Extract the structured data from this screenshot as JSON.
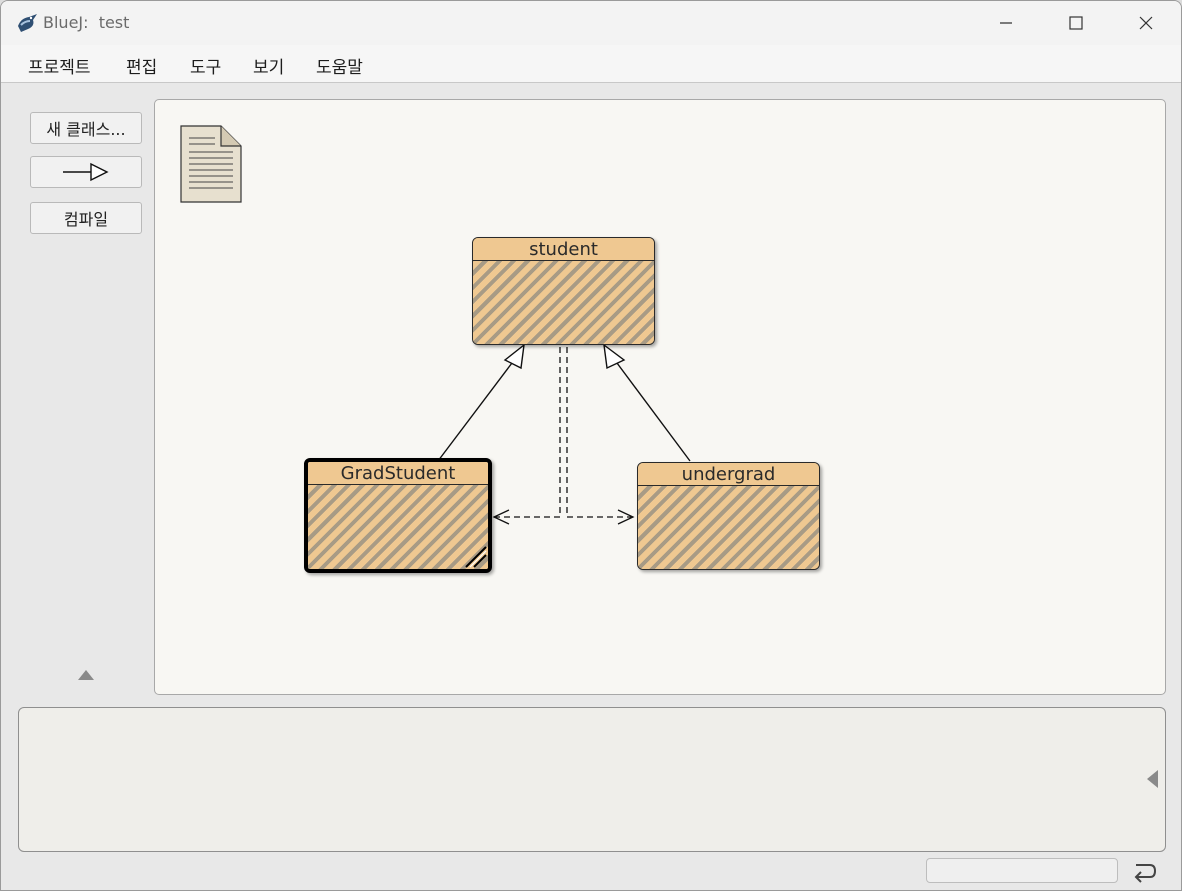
{
  "window": {
    "app_name": "BlueJ:",
    "project_name": "test",
    "title": "BlueJ:  test"
  },
  "menu": {
    "items": [
      "프로젝트",
      "편집",
      "도구",
      "보기",
      "도움말"
    ]
  },
  "sidebar": {
    "new_class_label": "새 클래스...",
    "compile_label": "컴파일"
  },
  "diagram": {
    "classes": [
      {
        "name": "student",
        "selected": false
      },
      {
        "name": "GradStudent",
        "selected": true
      },
      {
        "name": "undergrad",
        "selected": false
      }
    ],
    "relations": [
      {
        "from": "GradStudent",
        "to": "student",
        "kind": "extends"
      },
      {
        "from": "undergrad",
        "to": "student",
        "kind": "extends"
      },
      {
        "from": "student",
        "to": "GradStudent",
        "kind": "uses"
      },
      {
        "from": "student",
        "to": "undergrad",
        "kind": "uses"
      }
    ],
    "colors": {
      "class_fill": "#efc891",
      "hatch": "#a89b85",
      "canvas": "#f8f7f3"
    }
  },
  "icons": {
    "readme": "document-icon",
    "inheritance_arrow": "arrow-icon",
    "sidebar_toggle": "triangle-up-icon",
    "terminal_toggle": "triangle-left-icon",
    "status_return": "return-arrow-icon"
  }
}
